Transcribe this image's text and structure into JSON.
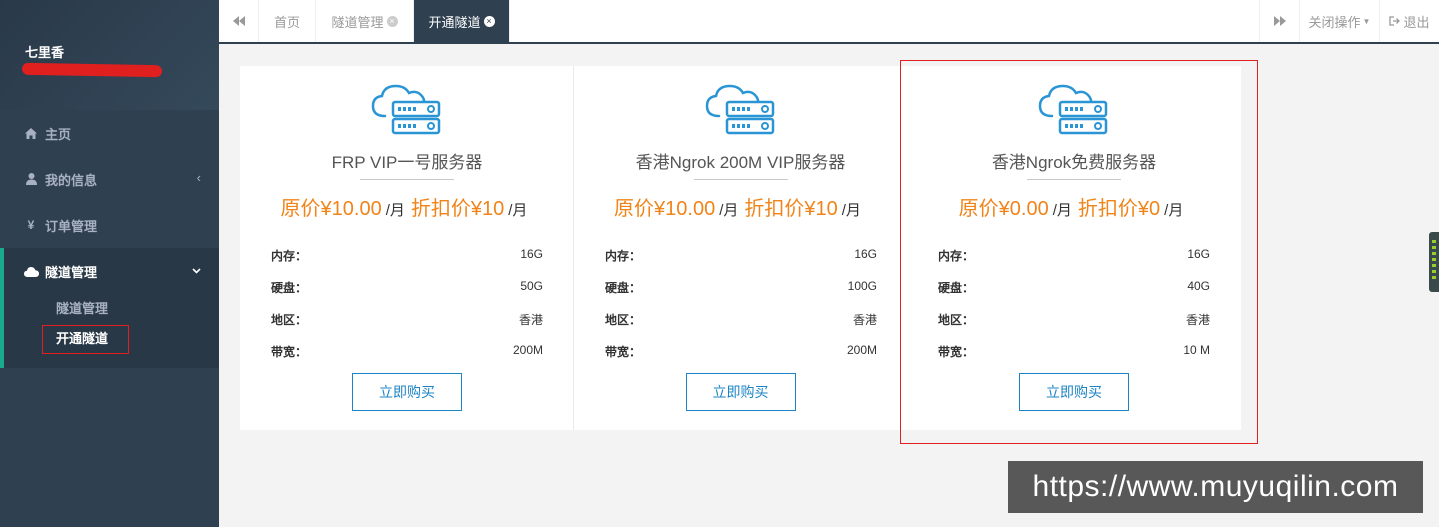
{
  "sidebar": {
    "username": "七里香",
    "nav": [
      {
        "label": "主页",
        "icon": "home-icon"
      },
      {
        "label": "我的信息",
        "icon": "user-icon"
      },
      {
        "label": "订单管理",
        "icon": "yen-icon"
      }
    ],
    "group": {
      "label": "隧道管理",
      "icon": "cloud-icon",
      "children": [
        "隧道管理",
        "开通隧道"
      ]
    }
  },
  "tabs": {
    "items": [
      "首页",
      "隧道管理",
      "开通隧道"
    ],
    "close_menu": "关闭操作",
    "logout": "退出"
  },
  "cards": [
    {
      "name": "FRP VIP一号服务器",
      "orig_price": "原价¥10.00",
      "unit": "/月",
      "disc_price": "折扣价¥10",
      "specs": [
        {
          "k": "内存：",
          "v": "16G"
        },
        {
          "k": "硬盘：",
          "v": "50G"
        },
        {
          "k": "地区：",
          "v": "香港"
        },
        {
          "k": "带宽：",
          "v": "200M"
        }
      ],
      "button": "立即购买"
    },
    {
      "name": "香港Ngrok 200M VIP服务器",
      "orig_price": "原价¥10.00",
      "unit": "/月",
      "disc_price": "折扣价¥10",
      "specs": [
        {
          "k": "内存：",
          "v": "16G"
        },
        {
          "k": "硬盘：",
          "v": "100G"
        },
        {
          "k": "地区：",
          "v": "香港"
        },
        {
          "k": "带宽：",
          "v": "200M"
        }
      ],
      "button": "立即购买"
    },
    {
      "name": "香港Ngrok免费服务器",
      "orig_price": "原价¥0.00",
      "unit": "/月",
      "disc_price": "折扣价¥0",
      "specs": [
        {
          "k": "内存：",
          "v": "16G"
        },
        {
          "k": "硬盘：",
          "v": "40G"
        },
        {
          "k": "地区：",
          "v": "香港"
        },
        {
          "k": "带宽：",
          "v": "10 M"
        }
      ],
      "button": "立即购买"
    }
  ],
  "watermark": "https://www.muyuqilin.com",
  "colors": {
    "sidebar_bg": "#2f4050",
    "accent_green": "#19aa8d",
    "price_orange": "#f08419",
    "button_blue": "#1c84c6",
    "highlight_red": "#e02020"
  }
}
